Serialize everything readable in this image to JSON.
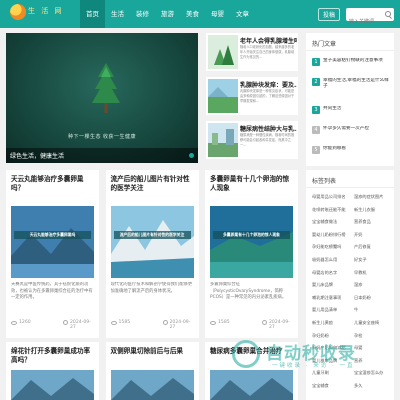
{
  "header": {
    "logo_text": "生 活 网",
    "nav": [
      "首页",
      "生活",
      "装修",
      "旅游",
      "美食",
      "母婴",
      "文章"
    ],
    "login_label": "投稿",
    "search_placeholder": "输入关键词"
  },
  "hero": {
    "slogan": "种下一棵生态  收获一生健康",
    "caption": "绿色生活，健康生活"
  },
  "featured": [
    {
      "title": "老年人会得乳腺增生吗",
      "desc": "随着人口老龄化的加剧，越来越多的老年人开始关注自己的身体健康，乳腺增生作为常见的..."
    },
    {
      "title": "乳腺肿块发痒：要及...",
      "desc": "乳腺肿块发痒是一种常见症状，可能是由多种原因引起的，了解这些原因对于早期发现和..."
    },
    {
      "title": "糖尿病性结肿大与乳...",
      "desc": "糖尿病是一种慢性疾病，随着时间的推移可能会引起各种并发症，而其中之一..."
    }
  ],
  "sidebar": {
    "recommend_title": "热门文章",
    "recommend": [
      "金子美容粘钉物联的注意事项",
      "幸福的生活,幸福的生活是什么样子",
      "共同生活",
      "怀孕多久需要一次产检",
      "你能到哪看"
    ],
    "tags_title": "标签列表",
    "tags": [
      [
        "母婴用品公司排名",
        "湿疹的症状图片"
      ],
      [
        "花呗转账还能不能",
        "新生儿衣服"
      ],
      [
        "宝宝辅食做法",
        "营养食品"
      ],
      [
        "婴幼儿奶粉排行榜",
        "开奶"
      ],
      [
        "孕妇能吃螃蟹吗",
        "产后修复"
      ],
      [
        "吸奶器怎么用",
        "好女子"
      ],
      [
        "母婴店的名字",
        "早教机"
      ],
      [
        "婴儿床品牌",
        "湿疹"
      ],
      [
        "哺乳期注意事项",
        "日本奶粉"
      ],
      [
        "婴儿用品清单",
        "牛"
      ],
      [
        "新生儿黄疸",
        "儿童安全座椅"
      ],
      [
        "孕妇奶粉",
        "孕检"
      ],
      [
        "妈妈产后如何减肥",
        "母婴"
      ],
      [
        "婴儿推车品牌",
        "营养"
      ],
      [
        "儿童牙刷",
        "宝宝湿疹怎么办"
      ],
      [
        "宝宝辅食",
        "多久"
      ]
    ]
  },
  "cards": [
    {
      "title": "天云丸能够治疗多囊卵巢吗？",
      "img_label": "天云丸能够治疗多囊卵巢吗",
      "desc": "天赛丸是中医传统药，其于祛瘀化痰的功效，也被认为在多囊卵巢综合征的治疗中有一定的作用。",
      "views": "1260",
      "date": "2024-09-27"
    },
    {
      "title": "流产后的船儿图片有针对性的医学关注",
      "img_label": "流产后的船儿图片有针对性的医学关注",
      "desc": "现代化的医疗技术和解剖学使得我们能够更加准确地了解流产后的身体状况。",
      "views": "1585",
      "date": "2024-09-27"
    },
    {
      "title": "多囊卵巢有十几个卵泡的惊人现象",
      "img_label": "多囊卵巢有十几个卵泡的惊人现象",
      "desc": "多囊卵巢综合征（PolycysticOvarySyndrome，简称PCOS）是一种常见的内分泌紊乱疾病。",
      "views": "1585",
      "date": "2024-09-27"
    },
    {
      "title": "绵花针打开多囊卵巢成功率高吗？",
      "img_label": "",
      "desc": "",
      "views": "",
      "date": ""
    },
    {
      "title": "双侧卵巢切除前后与后果",
      "img_label": "",
      "desc": "",
      "views": "",
      "date": ""
    },
    {
      "title": "糖尿病多囊卵巢合并治疗",
      "img_label": "",
      "desc": "",
      "views": "",
      "date": ""
    }
  ],
  "watermark": {
    "title": "自动秒收录",
    "sub": "一键收录 · 来访 · 一直"
  },
  "colors": {
    "accent": "#1aa79b",
    "accent_dark": "#0f877d"
  }
}
